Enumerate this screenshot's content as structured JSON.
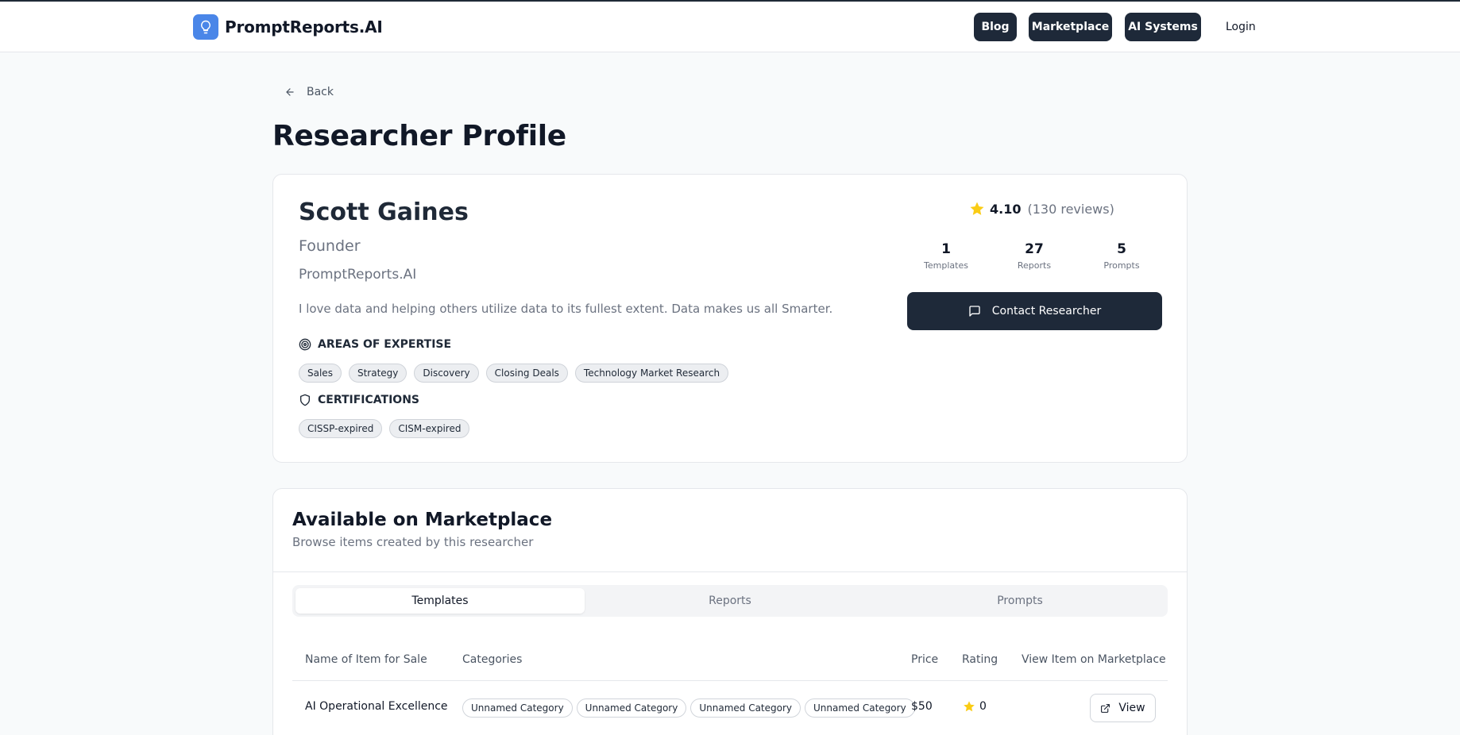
{
  "header": {
    "brand": "PromptReports.AI",
    "nav": [
      {
        "label": "Blog"
      },
      {
        "label": "Marketplace"
      },
      {
        "label": "AI Systems"
      }
    ],
    "login_label": "Login"
  },
  "back_label": "Back",
  "page_title": "Researcher Profile",
  "profile": {
    "name": "Scott Gaines",
    "role": "Founder",
    "company": "PromptReports.AI",
    "bio": "I love data and helping others utilize data to its fullest extent. Data makes us all Smarter.",
    "expertise_heading": "AREAS OF EXPERTISE",
    "expertise": [
      "Sales",
      "Strategy",
      "Discovery",
      "Closing Deals",
      "Technology Market Research"
    ],
    "certifications_heading": "CERTIFICATIONS",
    "certifications": [
      "CISSP-expired",
      "CISM-expired"
    ],
    "rating": "4.10",
    "reviews": "(130 reviews)",
    "stats": [
      {
        "value": "1",
        "label": "Templates"
      },
      {
        "value": "27",
        "label": "Reports"
      },
      {
        "value": "5",
        "label": "Prompts"
      }
    ],
    "contact_label": "Contact Researcher"
  },
  "marketplace": {
    "title": "Available on Marketplace",
    "subtitle": "Browse items created by this researcher",
    "tabs": [
      {
        "label": "Templates",
        "active": true
      },
      {
        "label": "Reports",
        "active": false
      },
      {
        "label": "Prompts",
        "active": false
      }
    ],
    "columns": [
      "Name of Item for Sale",
      "Categories",
      "Price",
      "Rating",
      "View Item on Marketplace"
    ],
    "rows": [
      {
        "name": "AI Operational Excellence",
        "categories": [
          "Unnamed Category",
          "Unnamed Category",
          "Unnamed Category",
          "Unnamed Category"
        ],
        "price": "$50",
        "rating": "0",
        "view_label": "View"
      }
    ]
  },
  "colors": {
    "brand_blue": "#4a86e8",
    "dark_button": "#1e2939",
    "star": "#facc15"
  }
}
